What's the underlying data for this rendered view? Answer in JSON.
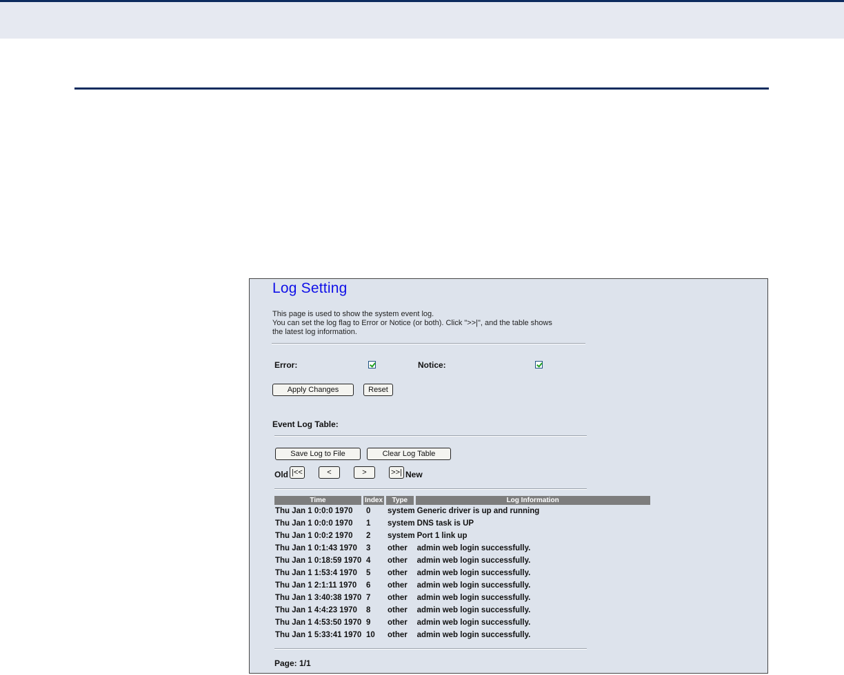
{
  "settings": {
    "title": "Log Setting",
    "description": [
      "This page is used to show the system event log.",
      "You can set the log flag to Error or Notice (or both). Click \">>|\", and the table shows",
      "the latest log information."
    ],
    "error_label": "Error:",
    "error_checked": true,
    "notice_label": "Notice:",
    "notice_checked": true,
    "apply_label": "Apply Changes",
    "reset_label": "Reset"
  },
  "event_log": {
    "heading": "Event Log Table:",
    "save_label": "Save Log to File",
    "clear_label": "Clear Log Table",
    "nav": {
      "old_label": "Old",
      "first": "|<<",
      "prev": "<",
      "next": ">",
      "last": ">>|",
      "new_label": "New"
    },
    "columns": [
      "Time",
      "Index",
      "Type",
      "Log Information"
    ],
    "rows": [
      [
        "Thu Jan 1 0:0:0 1970",
        "0",
        "system",
        "Generic driver is up and running"
      ],
      [
        "Thu Jan 1 0:0:0 1970",
        "1",
        "system",
        "DNS task is UP"
      ],
      [
        "Thu Jan 1 0:0:2 1970",
        "2",
        "system",
        "Port 1 link up"
      ],
      [
        "Thu Jan 1 0:1:43 1970",
        "3",
        "other",
        "admin web login successfully."
      ],
      [
        "Thu Jan 1 0:18:59 1970",
        "4",
        "other",
        "admin web login successfully."
      ],
      [
        "Thu Jan 1 1:53:4 1970",
        "5",
        "other",
        "admin web login successfully."
      ],
      [
        "Thu Jan 1 2:1:11 1970",
        "6",
        "other",
        "admin web login successfully."
      ],
      [
        "Thu Jan 1 3:40:38 1970",
        "7",
        "other",
        "admin web login successfully."
      ],
      [
        "Thu Jan 1 4:4:23 1970",
        "8",
        "other",
        "admin web login successfully."
      ],
      [
        "Thu Jan 1 4:53:50 1970",
        "9",
        "other",
        "admin web login successfully."
      ],
      [
        "Thu Jan 1 5:33:41 1970",
        "10",
        "other",
        "admin web login successfully."
      ]
    ],
    "page_label": "Page: 1/1"
  }
}
